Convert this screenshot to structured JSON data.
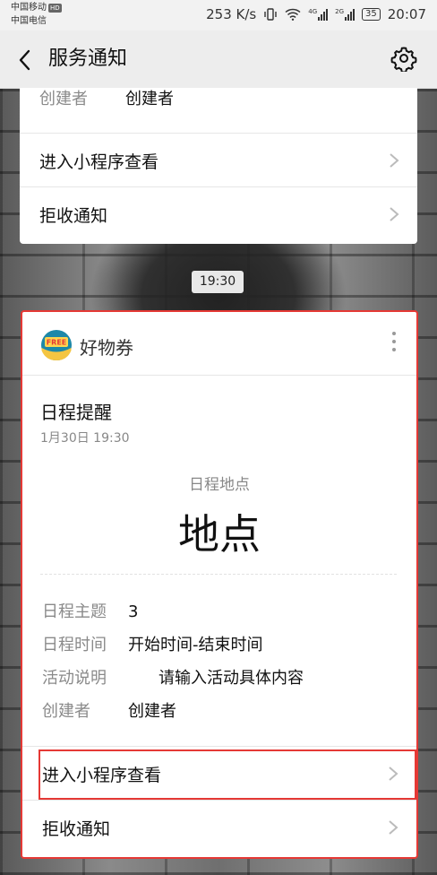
{
  "status_bar": {
    "carrier1": "中国移动",
    "hd_badge": "HD",
    "carrier2": "中国电信",
    "net_speed": "253 K/s",
    "net_4g": "4G",
    "net_2g": "2G",
    "battery": "35",
    "clock": "20:07"
  },
  "nav": {
    "title": "服务通知"
  },
  "prev_card": {
    "creator_key": "创建者",
    "creator_val": "创建者",
    "open_label": "进入小程序查看",
    "reject_label": "拒收通知"
  },
  "time_separator": "19:30",
  "card": {
    "logo_text": "FREE",
    "brand": "好物券",
    "title": "日程提醒",
    "date": "1月30日  19:30",
    "location_label": "日程地点",
    "location_value": "地点",
    "rows": [
      {
        "key": "日程主题",
        "value": "3"
      },
      {
        "key": "日程时间",
        "value": "开始时间-结束时间"
      },
      {
        "key": "活动说明",
        "value": "请输入活动具体内容"
      },
      {
        "key": "创建者",
        "value": "创建者"
      }
    ],
    "open_label": "进入小程序查看",
    "reject_label": "拒收通知"
  },
  "colors": {
    "highlight": "#e53935",
    "logo_blue": "#1e88a8",
    "logo_yellow": "#ffd54f",
    "logo_red": "#e53935"
  }
}
